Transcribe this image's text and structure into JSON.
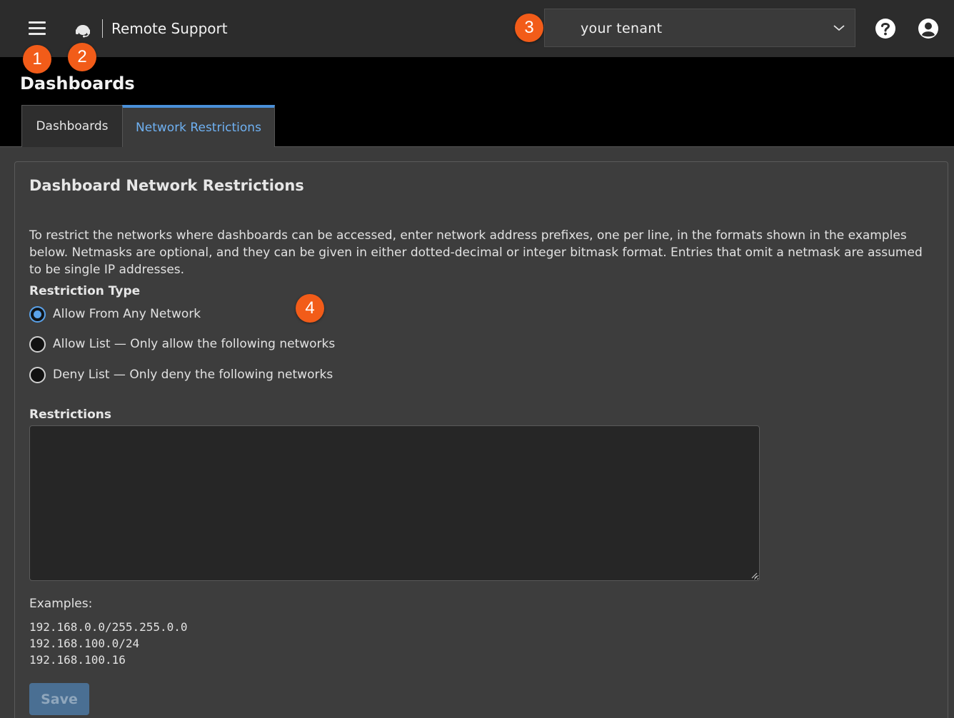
{
  "header": {
    "app_title": "Remote Support",
    "app_icon": "headset-icon",
    "menu_icon": "hamburger-menu-icon",
    "tenant_value": "your tenant",
    "help_icon": "help-icon",
    "user_icon": "user-account-icon"
  },
  "callouts": [
    "1",
    "2",
    "3",
    "4"
  ],
  "page": {
    "title": "Dashboards",
    "tabs": [
      {
        "label": "Dashboards",
        "active": false
      },
      {
        "label": "Network Restrictions",
        "active": true
      }
    ]
  },
  "panel": {
    "title": "Dashboard Network Restrictions",
    "description": "To restrict the networks where dashboards can be accessed, enter network address prefixes, one per line, in the formats shown in the examples below. Netmasks are optional, and they can be given in either dotted-decimal or integer bitmask format. Entries that omit a netmask are assumed to be single IP addresses.",
    "restriction_type_label": "Restriction Type",
    "options": [
      {
        "label": "Allow From Any Network",
        "checked": true
      },
      {
        "label": "Allow List — Only allow the following networks",
        "checked": false
      },
      {
        "label": "Deny List — Only deny the following networks",
        "checked": false
      }
    ],
    "restrictions_label": "Restrictions",
    "restrictions_value": "",
    "examples_label": "Examples:",
    "examples": [
      "192.168.0.0/255.255.0.0",
      "192.168.100.0/24",
      "192.168.100.16"
    ],
    "save_label": "Save"
  },
  "colors": {
    "accent": "#4a90d9",
    "callout": "#f25c19",
    "topbar": "#2c2c2c",
    "panel": "#3d3d3d"
  }
}
